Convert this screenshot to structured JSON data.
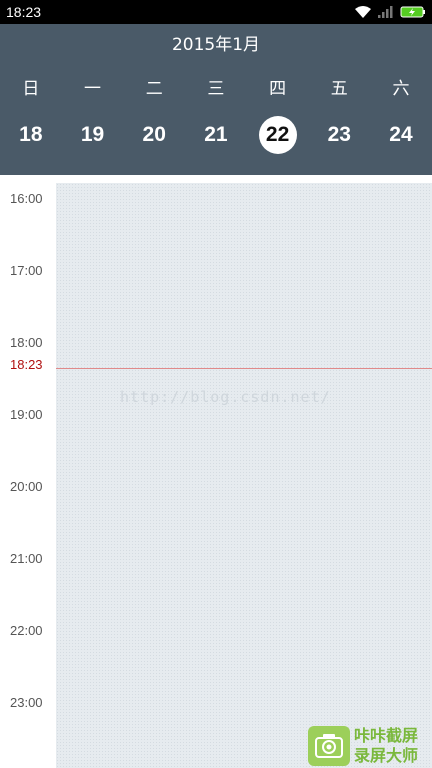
{
  "status_bar": {
    "time": "18:23",
    "icons": [
      "wifi-icon",
      "signal-icon",
      "battery-icon"
    ],
    "battery_color": "#55cc22"
  },
  "calendar": {
    "month_title": "2015年1月",
    "weekdays": [
      "日",
      "一",
      "二",
      "三",
      "四",
      "五",
      "六"
    ],
    "dates": [
      "18",
      "19",
      "20",
      "21",
      "22",
      "23",
      "24"
    ],
    "selected_date": "22",
    "header_color": "#4a5a68"
  },
  "timeline": {
    "hours": [
      "16:00",
      "17:00",
      "18:00",
      "19:00",
      "20:00",
      "21:00",
      "22:00",
      "23:00"
    ],
    "current_time": "18:23",
    "current_time_color": "#b01010"
  },
  "watermark": {
    "url_text": "http://blog.csdn.net/",
    "logo_line1": "咔咔截屏",
    "logo_line2": "录屏大师"
  }
}
